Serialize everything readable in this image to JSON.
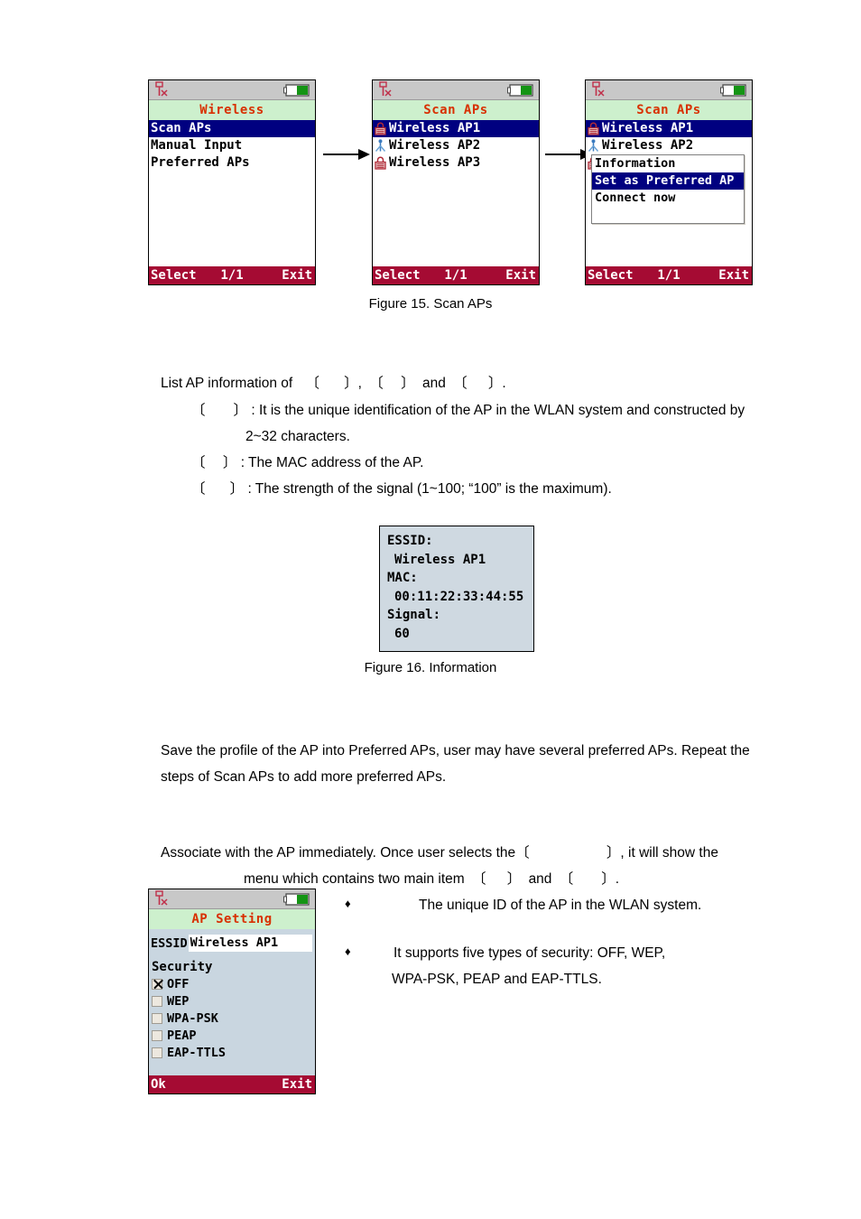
{
  "screens": {
    "wireless": {
      "title": "Wireless",
      "items": [
        {
          "label": "Scan APs",
          "selected": true
        },
        {
          "label": "Manual Input",
          "selected": false
        },
        {
          "label": "Preferred APs",
          "selected": false
        }
      ],
      "softkeys": {
        "left": "Select",
        "middle": "1/1",
        "right": "Exit"
      },
      "status": {
        "signal_icon": "antenna-no-signal-icon",
        "battery_icon": "battery-icon"
      }
    },
    "scan_aps": {
      "title": "Scan APs",
      "items": [
        {
          "label": "Wireless AP1",
          "icon": "lock-icon",
          "selected": true
        },
        {
          "label": "Wireless AP2",
          "icon": "open-network-icon",
          "selected": false
        },
        {
          "label": "Wireless AP3",
          "icon": "lock-icon",
          "selected": false
        }
      ],
      "softkeys": {
        "left": "Select",
        "middle": "1/1",
        "right": "Exit"
      }
    },
    "scan_aps_menu": {
      "title": "Scan APs",
      "items": [
        {
          "label": "Wireless AP1",
          "icon": "lock-icon",
          "selected": true
        },
        {
          "label": "Wireless AP2",
          "icon": "open-network-icon",
          "selected": false
        },
        {
          "label": "Wireless AP3",
          "icon": "lock-icon",
          "selected": false
        }
      ],
      "popup": [
        {
          "label": "Information",
          "selected": false
        },
        {
          "label": "Set as Preferred AP",
          "selected": true
        },
        {
          "label": "Connect now",
          "selected": false
        }
      ],
      "softkeys": {
        "left": "Select",
        "middle": "1/1",
        "right": "Exit"
      }
    },
    "ap_setting": {
      "title": "AP Setting",
      "essid_label": "ESSID",
      "essid_value": "Wireless AP1",
      "security_label": "Security",
      "security_options": [
        {
          "label": "OFF",
          "checked": true
        },
        {
          "label": "WEP",
          "checked": false
        },
        {
          "label": "WPA-PSK",
          "checked": false
        },
        {
          "label": "PEAP",
          "checked": false
        },
        {
          "label": "EAP-TTLS",
          "checked": false
        }
      ],
      "softkeys": {
        "left": "Ok",
        "middle": "",
        "right": "Exit"
      }
    }
  },
  "info_box": {
    "essid_label": "ESSID:",
    "essid_value": "Wireless AP1",
    "mac_label": "MAC:",
    "mac_value": "00:11:22:33:44:55",
    "signal_label": "Signal:",
    "signal_value": "60"
  },
  "captions": {
    "figure15": "Figure 15. Scan APs",
    "figure16": "Figure 16. Information"
  },
  "body": {
    "line_list_ap_a": "List AP information of",
    "line_list_ap_b": ",",
    "line_list_ap_c": "and",
    "line_list_ap_d": ".",
    "essid_desc_a": ": It is the unique identification of the AP in the WLAN system and constructed by",
    "essid_desc_b": "2~32 characters.",
    "mac_desc": ": The MAC address of the AP.",
    "signal_desc": ": The strength of the signal (1~100; “100” is the maximum).",
    "preferred_line1": "Save the profile of the AP into Preferred APs, user may have several preferred APs. Repeat the",
    "preferred_line2": "steps of Scan APs to add more preferred APs.",
    "connect_line1_a": "Associate with the AP immediately. Once user selects the",
    "connect_line1_b": ", it will show the",
    "connect_line2_a": "menu which contains two main item",
    "connect_line2_b": "and",
    "connect_line2_c": ".",
    "bullet1": "The unique ID of the AP in the WLAN system.",
    "bullet2_line1": "It supports five types of security: OFF, WEP,",
    "bullet2_line2": "WPA-PSK, PEAP and EAP-TTLS.",
    "bullet_glyph": "♦",
    "bracket_open": "〔",
    "bracket_close": "〕"
  }
}
